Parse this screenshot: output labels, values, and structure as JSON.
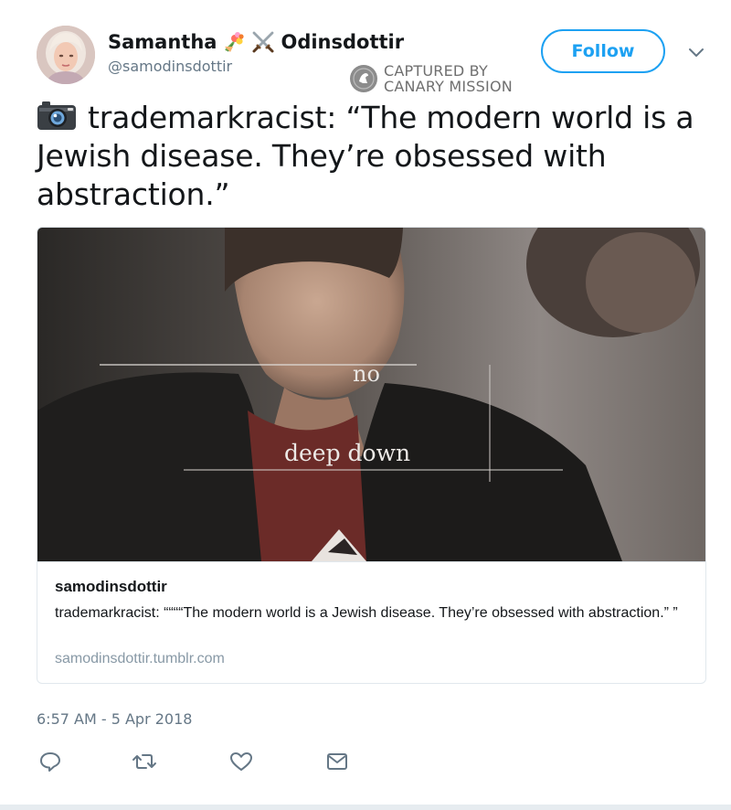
{
  "author": {
    "name_first": "Samantha",
    "name_last": "Odinsdottir",
    "name_emojis": [
      "bouquet-icon",
      "crossed-swords-icon"
    ],
    "handle": "@samodinsdottir",
    "avatar": "avatar"
  },
  "header": {
    "follow_label": "Follow",
    "menu_icon": "chevron-down-icon"
  },
  "watermark": {
    "line1": "CAPTURED BY",
    "line2": "CANARY MISSION",
    "logo": "canary-mission-logo"
  },
  "tweet": {
    "leading_icon": "camera-icon",
    "text": "trademarkracist: “The modern world is a Jewish disease. They’re obsessed with abstraction.”"
  },
  "card": {
    "image_captions": [
      "no",
      "deep down"
    ],
    "title": "samodinsdottir",
    "description": "trademarkracist: ““““The modern world is a Jewish disease. They’re obsessed with abstraction.” ”",
    "domain": "samodinsdottir.tumblr.com"
  },
  "footer": {
    "timestamp": "6:57 AM - 5 Apr 2018",
    "actions": [
      "reply-icon",
      "retweet-icon",
      "like-icon",
      "message-icon"
    ]
  },
  "colors": {
    "accent": "#1da1f2",
    "secondary_text": "#657786",
    "border": "#e1e8ed"
  }
}
